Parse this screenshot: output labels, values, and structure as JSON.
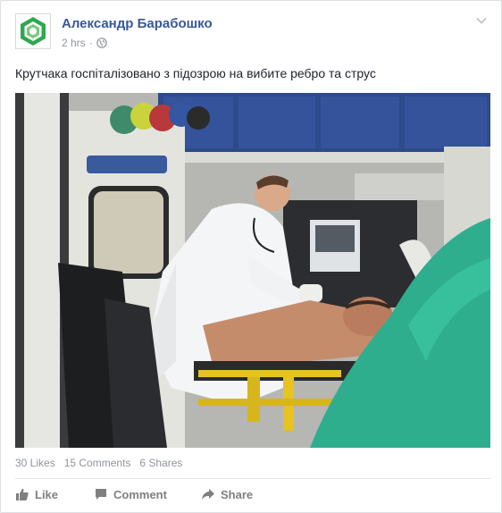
{
  "post": {
    "author": "Александр Барабошко",
    "time": "2 hrs",
    "separator": "·",
    "text": "Крутчака госпіталізовано з підозрою на вибите ребро та струс",
    "likes": "30 Likes",
    "comments": "15 Comments",
    "shares": "6 Shares"
  },
  "actions": {
    "like": "Like",
    "comment": "Comment",
    "share": "Share"
  },
  "icons": {
    "privacy": "globe-icon",
    "menu": "chevron-down-icon",
    "like": "thumbs-up-icon",
    "comment": "speech-bubble-icon",
    "share": "share-arrow-icon"
  },
  "colors": {
    "author_link": "#365899",
    "meta_gray": "#90949c",
    "action_gray": "#7f7f7f",
    "avatar_green": "#2fa84f"
  }
}
